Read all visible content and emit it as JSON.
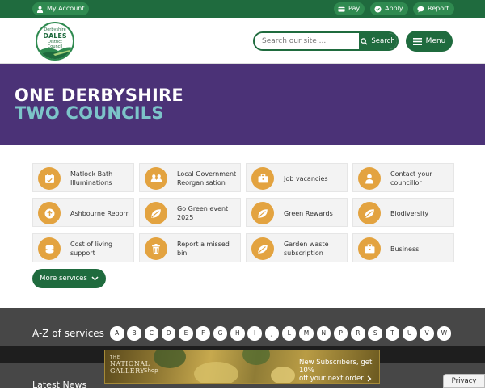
{
  "topbar": {
    "account_label": "My Account",
    "pay_label": "Pay",
    "apply_label": "Apply",
    "report_label": "Report"
  },
  "header": {
    "logo": {
      "line1": "Derbyshire",
      "line2": "DALES",
      "line3": "District",
      "line4": "Council"
    },
    "search_placeholder": "Search our site ...",
    "search_button": "Search",
    "menu_button": "Menu"
  },
  "hero": {
    "line1": "ONE DERBYSHIRE",
    "line2": "TWO COUNCILS"
  },
  "tiles": [
    {
      "label": "Matlock Bath Illuminations",
      "icon": "calendar-icon"
    },
    {
      "label": "Local Government Reorganisation",
      "icon": "people-icon"
    },
    {
      "label": "Job vacancies",
      "icon": "briefcase-icon"
    },
    {
      "label": "Contact your councillor",
      "icon": "person-icon"
    },
    {
      "label": "Ashbourne Reborn",
      "icon": "upload-icon"
    },
    {
      "label": "Go Green event 2025",
      "icon": "leaf-icon"
    },
    {
      "label": "Green Rewards",
      "icon": "leaf-icon"
    },
    {
      "label": "Biodiversity",
      "icon": "leaf-icon"
    },
    {
      "label": "Cost of living support",
      "icon": "coins-icon"
    },
    {
      "label": "Report a missed bin",
      "icon": "bin-icon"
    },
    {
      "label": "Garden waste subscription",
      "icon": "leaf-icon"
    },
    {
      "label": "Business",
      "icon": "briefcase-icon"
    }
  ],
  "more_services": "More services",
  "az": {
    "title": "A-Z of services",
    "letters": [
      "A",
      "B",
      "C",
      "D",
      "E",
      "F",
      "G",
      "H",
      "I",
      "J",
      "L",
      "M",
      "N",
      "P",
      "R",
      "S",
      "T",
      "U",
      "V",
      "W"
    ]
  },
  "latest_news": "Latest News",
  "ad": {
    "brand_top": "THE",
    "brand_name": "NATIONAL GALLERY",
    "brand_shop": "Shop",
    "promo_line1": "New Subscribers, get 10%",
    "promo_line2": "off your next order"
  },
  "privacy": "Privacy",
  "colors": {
    "brand_green": "#1f6b3e",
    "hero_purple": "#4b3277",
    "hero_teal": "#7cc4c9",
    "tile_icon": "#e3a340",
    "az_bg": "#474747"
  }
}
